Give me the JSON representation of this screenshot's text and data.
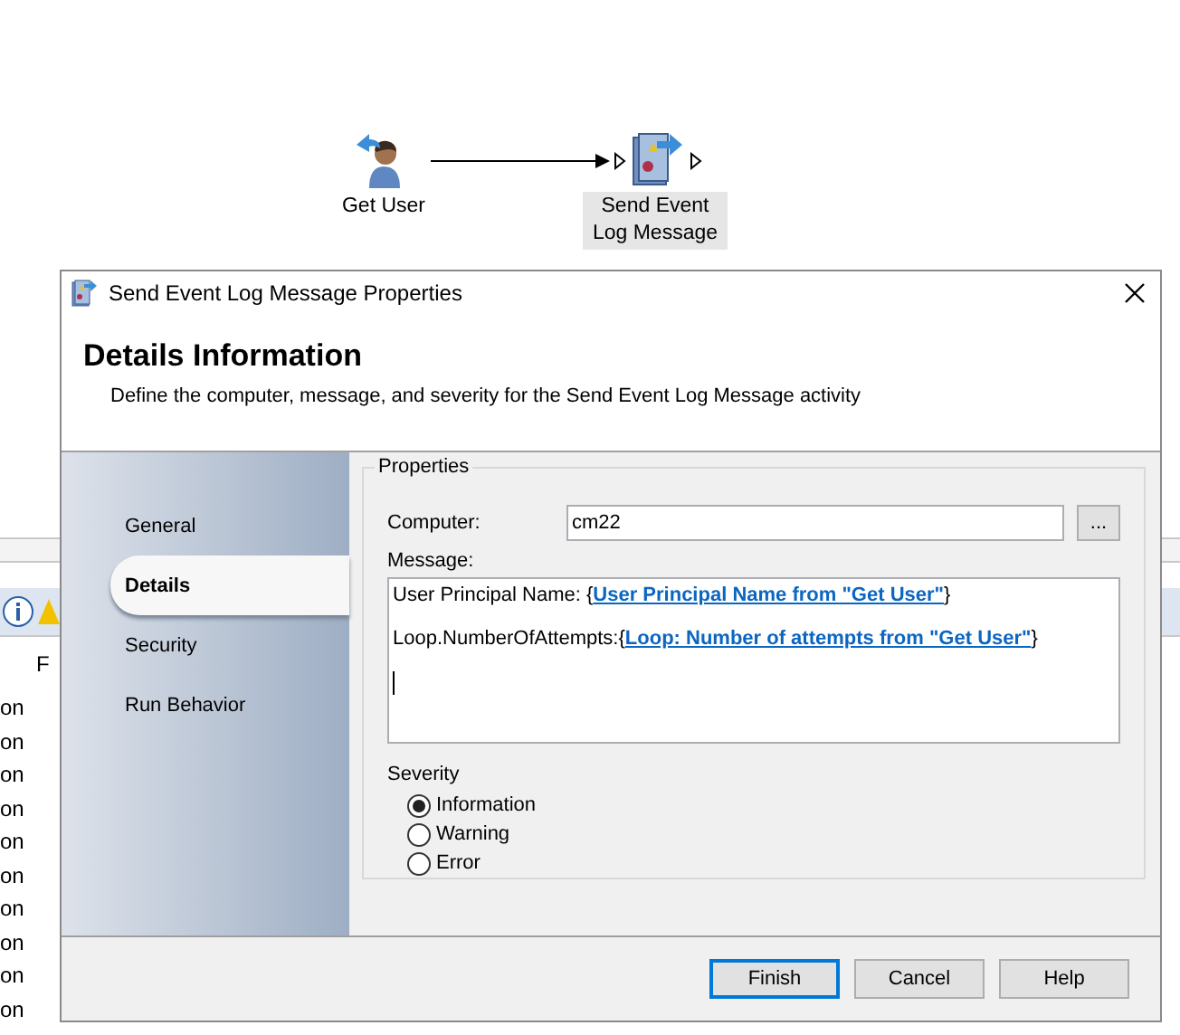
{
  "canvas": {
    "nodes": [
      {
        "label": "Get User",
        "kind": "user",
        "selected": false
      },
      {
        "label": "Send Event Log Message",
        "kind": "event-log",
        "selected": true
      }
    ]
  },
  "log_panel": {
    "column_1": "F",
    "rows": [
      "on",
      "on",
      "on",
      "on",
      "on",
      "on",
      "on",
      "on",
      "on",
      "on"
    ]
  },
  "dialog": {
    "title": "Send Event Log Message Properties",
    "heading": "Details Information",
    "description": "Define the computer, message, and severity for the Send Event Log Message activity",
    "nav": [
      {
        "label": "General",
        "selected": false
      },
      {
        "label": "Details",
        "selected": true
      },
      {
        "label": "Security",
        "selected": false
      },
      {
        "label": "Run Behavior",
        "selected": false
      }
    ],
    "properties": {
      "legend": "Properties",
      "computer_label": "Computer:",
      "computer_value": "cm22",
      "browse": "...",
      "message_label": "Message:",
      "message_lines": [
        {
          "prefix": "User Principal Name: {",
          "link": "User Principal Name from \"Get User\"",
          "suffix": "}"
        },
        {
          "prefix": "Loop.NumberOfAttempts:{",
          "link": "Loop: Number of attempts from \"Get User\"",
          "suffix": "}"
        }
      ],
      "severity_label": "Severity",
      "severity": [
        {
          "label": "Information",
          "selected": true
        },
        {
          "label": "Warning",
          "selected": false
        },
        {
          "label": "Error",
          "selected": false
        }
      ]
    },
    "buttons": [
      {
        "label": "Finish",
        "default": true
      },
      {
        "label": "Cancel",
        "default": false
      },
      {
        "label": "Help",
        "default": false
      }
    ]
  }
}
